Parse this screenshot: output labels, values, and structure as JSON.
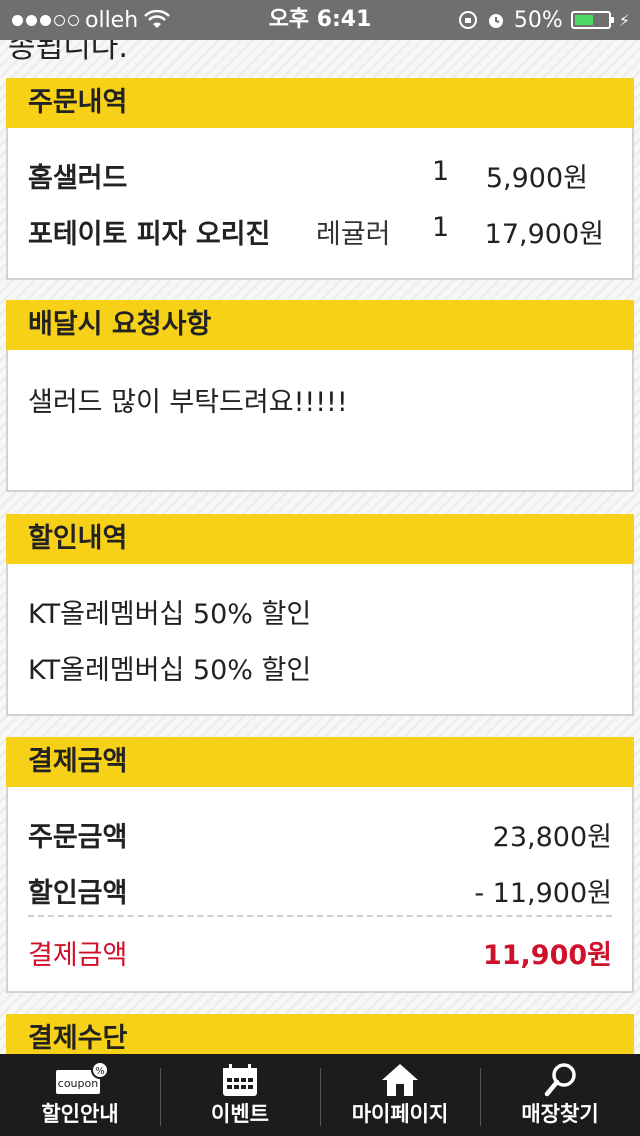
{
  "status_bar": {
    "carrier": "olleh",
    "time": "오후 6:41",
    "battery": "50%"
  },
  "partial_heading": "송됩니다.",
  "order": {
    "title": "주문내역",
    "items": [
      {
        "name": "홈샐러드",
        "option": "",
        "qty": "1",
        "price": "5,900원"
      },
      {
        "name": "포테이토 피자 오리진",
        "option": "레귤러",
        "qty": "1",
        "price": "17,900원"
      }
    ]
  },
  "request": {
    "title": "배달시 요청사항",
    "text": "샐러드 많이 부탁드려요!!!!!"
  },
  "discount": {
    "title": "할인내역",
    "items": [
      "KT올레멤버십 50% 할인",
      "KT올레멤버십 50% 할인"
    ]
  },
  "payment": {
    "title": "결제금액",
    "order_label": "주문금액",
    "order_value": "23,800원",
    "discount_label": "할인금액",
    "discount_value": "- 11,900원",
    "total_label": "결제금액",
    "total_value": "11,900원"
  },
  "method": {
    "title": "결제수단"
  },
  "tabs": [
    {
      "label": "할인안내",
      "icon": "coupon-icon",
      "badge": "coupon"
    },
    {
      "label": "이벤트",
      "icon": "calendar-icon"
    },
    {
      "label": "마이페이지",
      "icon": "home-icon"
    },
    {
      "label": "매장찾기",
      "icon": "search-icon"
    }
  ],
  "colors": {
    "section_header": "#f7d117",
    "total_red": "#d0112b",
    "tabbar": "#1c1c1c"
  }
}
